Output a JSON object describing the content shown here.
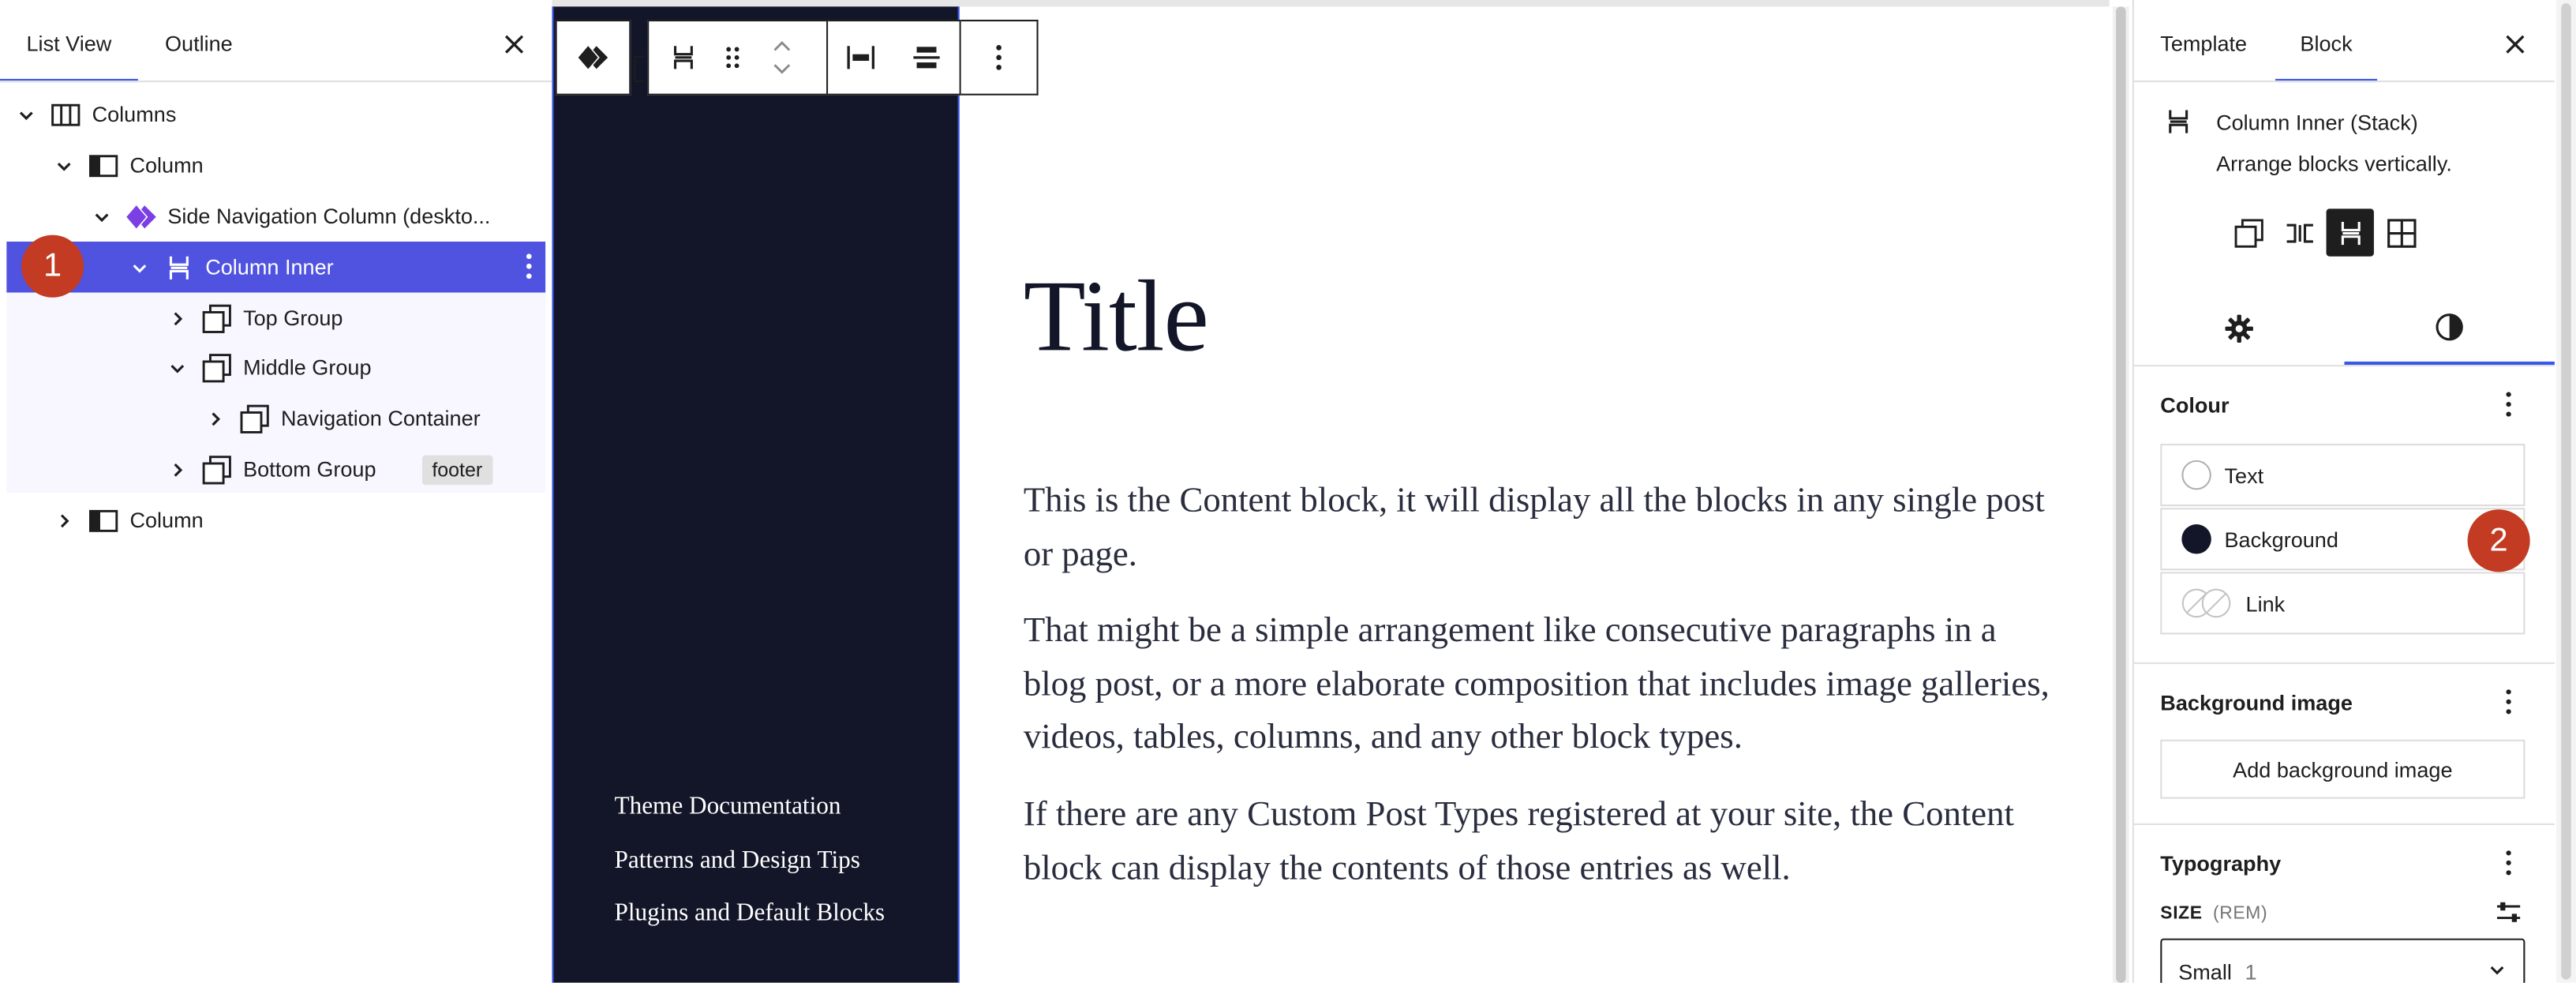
{
  "left_panel": {
    "tabs": [
      {
        "label": "List View"
      },
      {
        "label": "Outline"
      }
    ],
    "tree": [
      {
        "label": "Columns",
        "icon": "columns-icon",
        "expanded": true
      },
      {
        "label": "Column",
        "icon": "column-icon",
        "expanded": true
      },
      {
        "label": "Side Navigation Column (deskto...",
        "icon": "pattern-diamond-icon",
        "expanded": true
      },
      {
        "label": "Column Inner",
        "icon": "stack-icon",
        "expanded": true,
        "selected": true
      },
      {
        "label": "Top Group",
        "icon": "group-icon",
        "expanded": false
      },
      {
        "label": "Middle Group",
        "icon": "group-icon",
        "expanded": true
      },
      {
        "label": "Navigation Container",
        "icon": "group-icon",
        "expanded": false
      },
      {
        "label": "Bottom Group",
        "icon": "group-icon",
        "expanded": false,
        "tag": "footer"
      },
      {
        "label": "Column",
        "icon": "column-icon",
        "expanded": false
      }
    ],
    "badge": "1"
  },
  "canvas": {
    "title": "Title",
    "paragraphs": [
      "This is the Content block, it will display all the blocks in any single post or page.",
      "That might be a simple arrangement like consecutive paragraphs in a blog post, or a more elaborate composition that includes image galleries, videos, tables, columns, and any other block types.",
      "If there are any Custom Post Types registered at your site, the Content block can display the contents of those entries as well."
    ],
    "nav_links": [
      "Theme Documentation",
      "Patterns and Design Tips",
      "Plugins and Default Blocks"
    ],
    "background_color": "#131628"
  },
  "right_panel": {
    "tabs": [
      {
        "label": "Template"
      },
      {
        "label": "Block"
      }
    ],
    "block": {
      "name": "Column Inner (Stack)",
      "description": "Arrange blocks vertically."
    },
    "colour": {
      "title": "Colour",
      "items": [
        {
          "label": "Text",
          "swatch": "#ffffff"
        },
        {
          "label": "Background",
          "swatch": "#131628"
        },
        {
          "label": "Link",
          "swatch": "none"
        }
      ]
    },
    "background_image": {
      "title": "Background image",
      "button": "Add background image"
    },
    "typography": {
      "title": "Typography",
      "size_label": "SIZE",
      "size_unit": "(REM)",
      "size_value": "Small",
      "size_number": "1"
    },
    "badge": "2"
  },
  "colors": {
    "accent": "#3858e9",
    "selection": "#4f53df",
    "badge": "#c23b22",
    "dark": "#131628"
  }
}
